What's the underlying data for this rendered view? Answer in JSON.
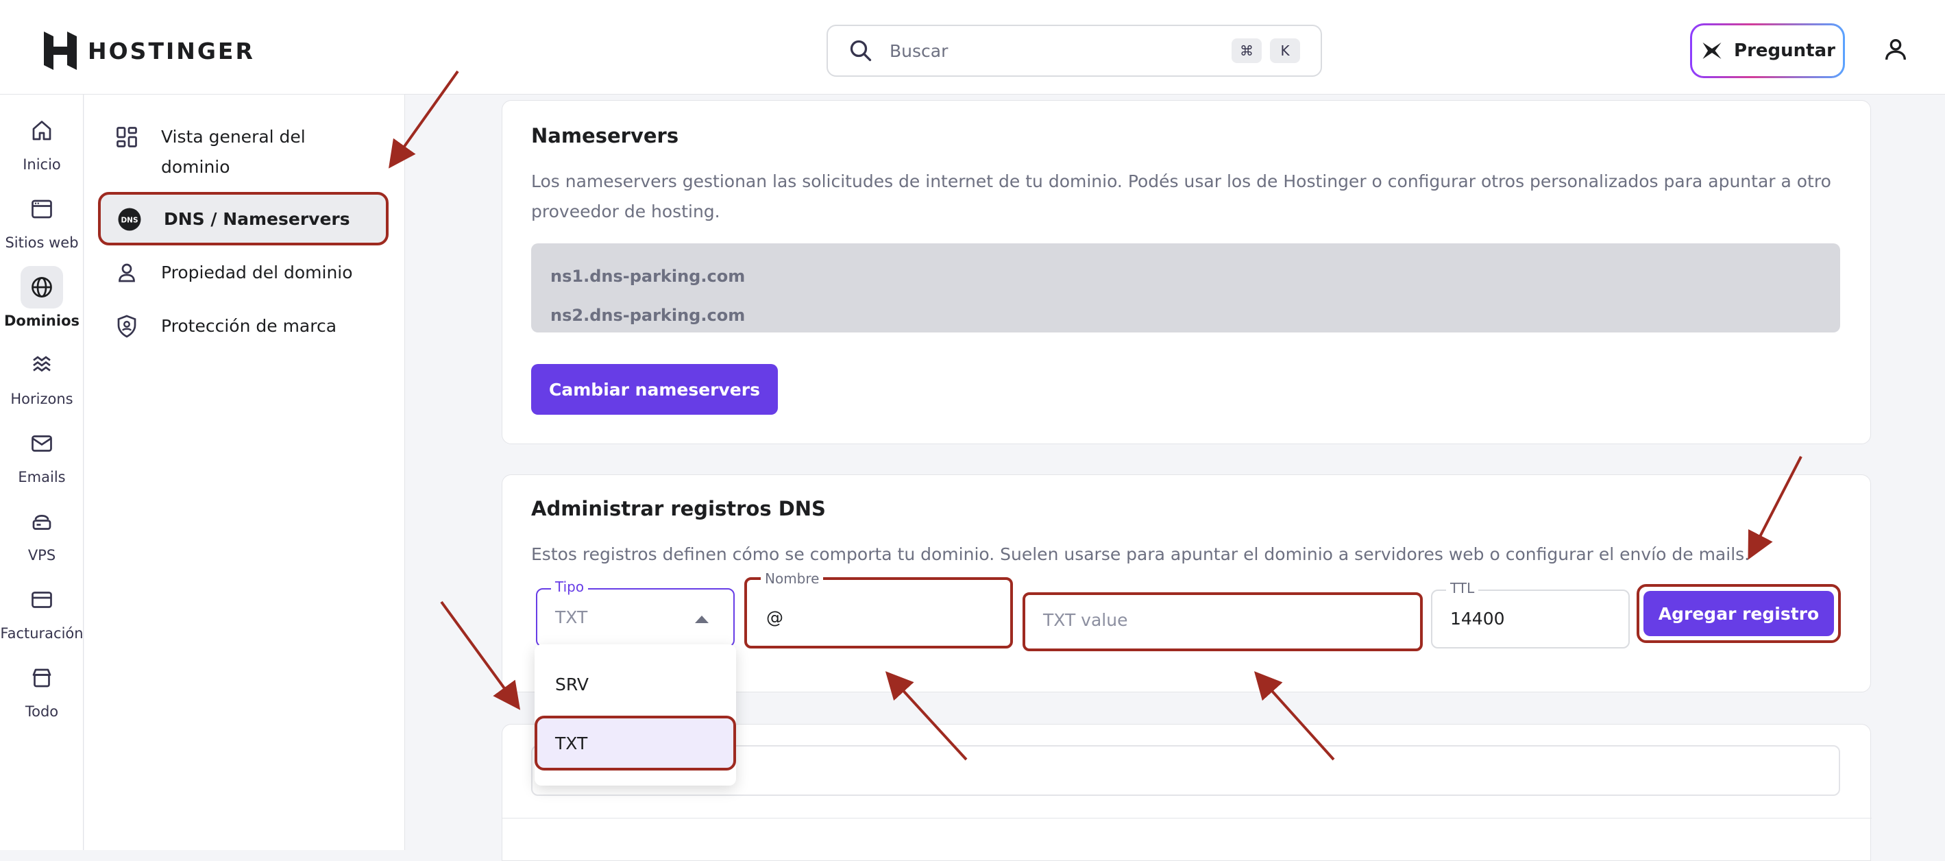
{
  "header": {
    "brand": "HOSTINGER",
    "search_placeholder": "Buscar",
    "shortcut_keys": [
      "⌘",
      "K"
    ],
    "ask_label": "Preguntar"
  },
  "rail": {
    "items": [
      {
        "label": "Inicio",
        "icon": "home-icon"
      },
      {
        "label": "Sitios web",
        "icon": "browser-icon"
      },
      {
        "label": "Dominios",
        "icon": "globe-icon",
        "active": true
      },
      {
        "label": "Horizons",
        "icon": "waves-icon"
      },
      {
        "label": "Emails",
        "icon": "mail-icon"
      },
      {
        "label": "VPS",
        "icon": "server-icon"
      },
      {
        "label": "Facturación",
        "icon": "card-icon"
      },
      {
        "label": "Todo",
        "icon": "store-icon"
      }
    ]
  },
  "subnav": {
    "items": [
      {
        "label": "Vista general del dominio",
        "icon": "dashboard-icon"
      },
      {
        "label": "DNS / Nameservers",
        "icon": "dns-icon",
        "active": true
      },
      {
        "label": "Propiedad del dominio",
        "icon": "person-icon"
      },
      {
        "label": "Protección de marca",
        "icon": "shield-icon"
      }
    ]
  },
  "nameservers": {
    "title": "Nameservers",
    "description": "Los nameservers gestionan las solicitudes de internet de tu dominio. Podés usar los de Hostinger o configurar otros personalizados para apuntar a otro proveedor de hosting.",
    "servers": [
      "ns1.dns-parking.com",
      "ns2.dns-parking.com"
    ],
    "change_button": "Cambiar nameservers"
  },
  "dns_records": {
    "title": "Administrar registros DNS",
    "description": "Estos registros definen cómo se comporta tu dominio. Suelen usarse para apuntar el dominio a servidores web o configurar el envío de mails.",
    "type_label": "Tipo",
    "type_value": "TXT",
    "name_label": "Nombre",
    "name_value": "@",
    "value_placeholder": "TXT value",
    "ttl_label": "TTL",
    "ttl_value": "14400",
    "add_button": "Agregar registro",
    "type_options": [
      "SRV",
      "TXT"
    ],
    "selected_option": "TXT"
  },
  "colors": {
    "brand": "#673de6",
    "annotation": "#9e2a20"
  }
}
